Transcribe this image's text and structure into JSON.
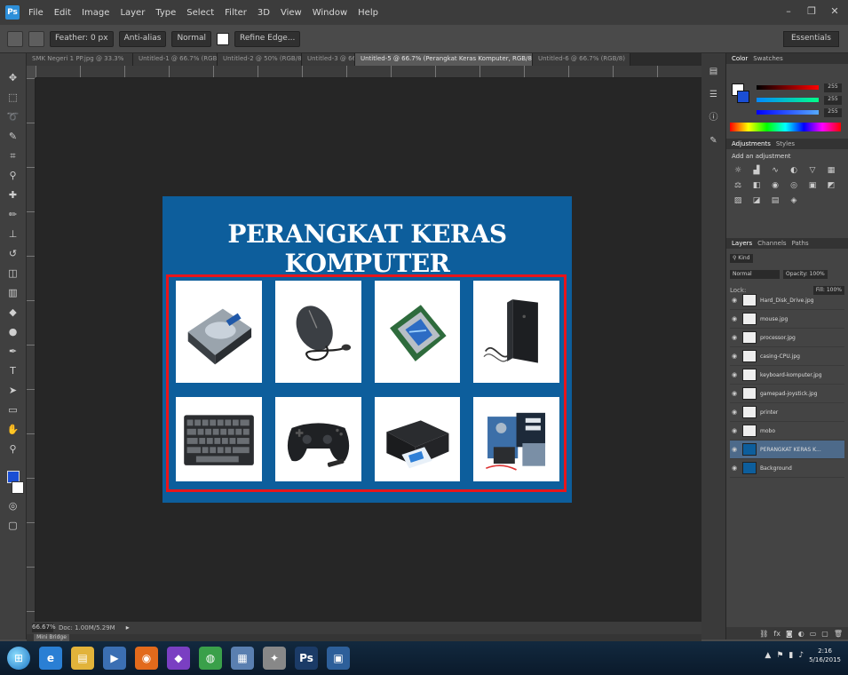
{
  "menubar": {
    "items": [
      "File",
      "Edit",
      "Image",
      "Layer",
      "Type",
      "Select",
      "Filter",
      "3D",
      "View",
      "Window",
      "Help"
    ]
  },
  "options": {
    "preset": "Feather: 0 px",
    "anti_alias": "Anti-alias",
    "style": "Normal",
    "refine": "Refine Edge...",
    "workspace": "Essentials"
  },
  "tabs": [
    {
      "label": "SMK Negeri 1 PP.jpg @ 33.3%",
      "active": false
    },
    {
      "label": "Untitled-1 @ 66.7% (RGB/8)",
      "active": false
    },
    {
      "label": "Untitled-2 @ 50% (RGB/8)",
      "active": false
    },
    {
      "label": "Untitled-3 @ 66.7%",
      "active": false
    },
    {
      "label": "Untitled-5 @ 66.7% (Perangkat Keras Komputer, RGB/8)",
      "active": true
    },
    {
      "label": "Untitled-6 @ 66.7% (RGB/8)",
      "active": false
    }
  ],
  "canvas": {
    "title": "PERANGKAT KERAS KOMPUTER",
    "items": [
      {
        "name": "Hard Disk",
        "icon": "harddisk-icon"
      },
      {
        "name": "Mouse",
        "icon": "mouse-icon"
      },
      {
        "name": "Processor",
        "icon": "processor-icon"
      },
      {
        "name": "CPU Case",
        "icon": "cpu-case-icon"
      },
      {
        "name": "Keyboard",
        "icon": "keyboard-icon"
      },
      {
        "name": "Gamepad",
        "icon": "gamepad-icon"
      },
      {
        "name": "Printer",
        "icon": "printer-icon"
      },
      {
        "name": "Motherboard",
        "icon": "motherboard-icon"
      }
    ]
  },
  "status": {
    "zoom": "66.67%",
    "doc": "Doc: 1.00M/5.29M"
  },
  "bottom_tab": "Mini Bridge",
  "panels": {
    "color_tabs": [
      "Color",
      "Swatches"
    ],
    "color_values": [
      "255",
      "255",
      "255"
    ],
    "adjust_tabs": [
      "Adjustments",
      "Styles"
    ],
    "adjust_title": "Add an adjustment",
    "layers_tabs": [
      "Layers",
      "Channels",
      "Paths"
    ],
    "blend_mode": "Normal",
    "opacity": "Opacity: 100%",
    "lock": "Lock:",
    "fill": "Fill: 100%",
    "layers": [
      {
        "name": "Hard_Disk_Drive.jpg",
        "blue": false,
        "active": false
      },
      {
        "name": "mouse.jpg",
        "blue": false,
        "active": false
      },
      {
        "name": "processor.jpg",
        "blue": false,
        "active": false
      },
      {
        "name": "casing-CPU.jpg",
        "blue": false,
        "active": false
      },
      {
        "name": "keyboard-komputer.jpg",
        "blue": false,
        "active": false
      },
      {
        "name": "gamepad-joystick.jpg",
        "blue": false,
        "active": false
      },
      {
        "name": "printer",
        "blue": false,
        "active": false
      },
      {
        "name": "mobo",
        "blue": false,
        "active": false
      },
      {
        "name": "PERANGKAT KERAS K...",
        "blue": true,
        "active": true
      },
      {
        "name": "Background",
        "blue": true,
        "active": false
      }
    ]
  },
  "taskbar": {
    "apps": [
      {
        "name": "Internet Explorer",
        "glyph": "e",
        "color": "#2a7fd4"
      },
      {
        "name": "File Explorer",
        "glyph": "▤",
        "color": "#e2b33a"
      },
      {
        "name": "Media Player",
        "glyph": "▶",
        "color": "#3b6fb3"
      },
      {
        "name": "Firefox",
        "glyph": "◉",
        "color": "#e26a1c"
      },
      {
        "name": "App",
        "glyph": "◆",
        "color": "#7a3fc2"
      },
      {
        "name": "Chrome",
        "glyph": "◍",
        "color": "#3aa04a"
      },
      {
        "name": "App 2",
        "glyph": "▦",
        "color": "#5a7fb0"
      },
      {
        "name": "App 3",
        "glyph": "✦",
        "color": "#888888"
      },
      {
        "name": "Photoshop",
        "glyph": "Ps",
        "color": "#1b3b67"
      },
      {
        "name": "App 4",
        "glyph": "▣",
        "color": "#2d5f9a"
      }
    ],
    "time": "2:16",
    "date": "5/16/2015"
  }
}
